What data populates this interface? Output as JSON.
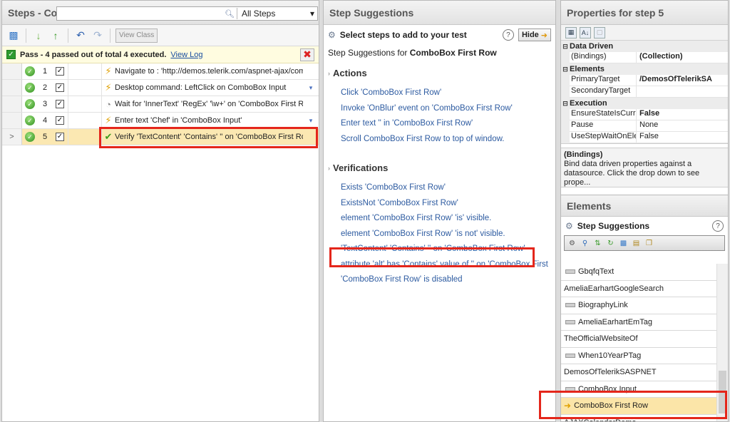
{
  "left": {
    "title": "Steps - Co",
    "search_placeholder": "",
    "filter_value": "All Steps",
    "view_class_label": "View Class",
    "pass_text": "Pass - 4 passed out of total 4 executed.",
    "view_log_label": "View Log",
    "steps": [
      {
        "num": "1",
        "icon": "lightning-icon",
        "desc": "Navigate to : 'http://demos.telerik.com/aspnet-ajax/comb",
        "selected": false
      },
      {
        "num": "2",
        "icon": "lightning-icon",
        "desc": "Desktop command: LeftClick on ComboBox Input",
        "selected": false
      },
      {
        "num": "3",
        "icon": "wait-icon",
        "desc": "Wait for 'InnerText' 'RegEx' '\\w+' on 'ComboBox First Row",
        "selected": false
      },
      {
        "num": "4",
        "icon": "lightning-icon",
        "desc": "Enter text 'Chef' in 'ComboBox Input'",
        "selected": false
      },
      {
        "num": "5",
        "icon": "verify-icon",
        "desc": "Verify 'TextContent' 'Contains' '' on 'ComboBox First Row'",
        "selected": true
      }
    ]
  },
  "mid": {
    "title": "Step Suggestions",
    "select_steps": "Select steps to add to your test",
    "hide_label": "Hide",
    "suggest_for_prefix": "Step Suggestions for ",
    "suggest_for_target": "ComboBox First Row",
    "actions_label": "Actions",
    "actions": [
      "Click 'ComboBox First Row'",
      "Invoke 'OnBlur' event on 'ComboBox First Row'",
      "Enter text '' in 'ComboBox First Row'",
      "Scroll ComboBox First Row to top of window."
    ],
    "verifications_label": "Verifications",
    "verifications": [
      "Exists 'ComboBox First Row'",
      "ExistsNot 'ComboBox First Row'",
      "element 'ComboBox First Row' 'is' visible.",
      "element 'ComboBox First Row' 'is not' visible.",
      "'TextContent' 'Contains' '' on 'ComboBox First Row'",
      "attribute 'alt' has 'Contains' value of '' on 'ComboBox First",
      "'ComboBox First Row' is disabled"
    ]
  },
  "right": {
    "title": "Properties for step 5",
    "props": {
      "data_driven": "Data Driven",
      "bindings_key": "(Bindings)",
      "bindings_val": "(Collection)",
      "elements": "Elements",
      "primary_key": "PrimaryTarget",
      "primary_val": "/DemosOfTelerikSA",
      "secondary_key": "SecondaryTarget",
      "execution": "Execution",
      "ensure_key": "EnsureStateIsCurre",
      "ensure_val": "False",
      "pause_key": "Pause",
      "pause_val": "None",
      "usestep_key": "UseStepWaitOnEle",
      "usestep_val": "False"
    },
    "desc_title": "(Bindings)",
    "desc_text": "Bind data driven properties against a datasource. Click the drop down to see prope...",
    "elements_title": "Elements",
    "step_suggestions_label": "Step Suggestions",
    "element_items": [
      {
        "label": "GbqfqText",
        "tag": true
      },
      {
        "label": "AmeliaEarhartGoogleSearch",
        "tag": false
      },
      {
        "label": "BiographyLink",
        "tag": true
      },
      {
        "label": "AmeliaEarhartEmTag",
        "tag": true
      },
      {
        "label": "TheOfficialWebsiteOf",
        "tag": false
      },
      {
        "label": "When10YearPTag",
        "tag": true
      },
      {
        "label": "DemosOfTelerikSASPNET",
        "tag": false
      },
      {
        "label": "ComboBox Input",
        "tag": true
      },
      {
        "label": "ComboBox First Row",
        "tag": false,
        "selected": true
      },
      {
        "label": "AJAXCalendarDemo",
        "tag": false
      }
    ]
  },
  "colors": {
    "highlight": "#e4261b",
    "link": "#2c5aa0",
    "selected_row": "#fbe8b2"
  }
}
